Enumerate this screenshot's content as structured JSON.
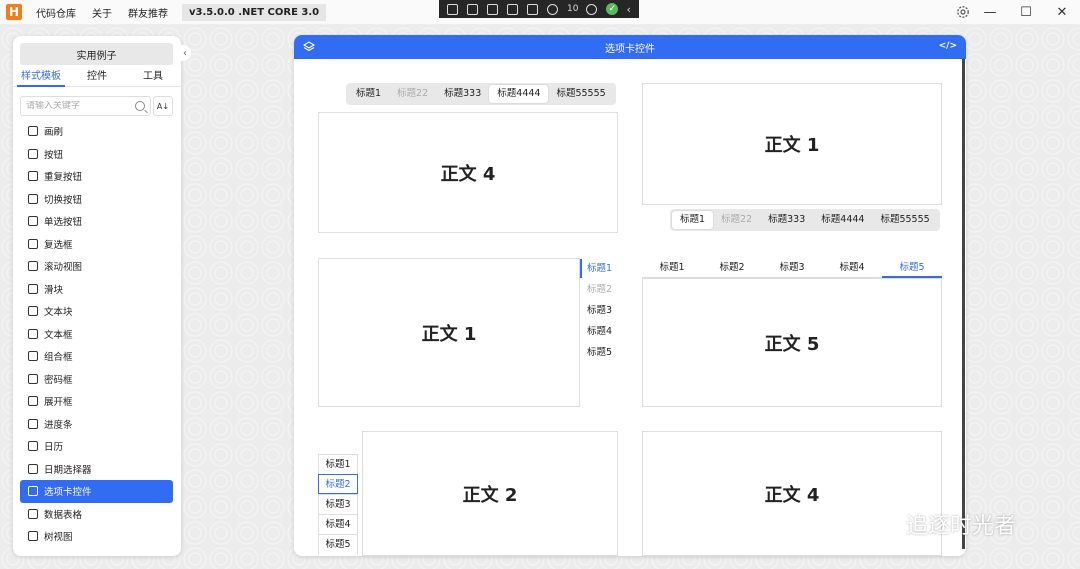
{
  "titlebar": {
    "logo": "H",
    "menu": [
      "代码仓库",
      "关于",
      "群友推荐"
    ],
    "version": "v3.5.0.0 .NET CORE 3.0",
    "debug_counter": "10",
    "controls": {
      "minimize": "—",
      "maximize": "☐",
      "close": "✕"
    }
  },
  "sidebar": {
    "examples_button": "实用例子",
    "tabs": [
      "样式模板",
      "控件",
      "工具"
    ],
    "active_tab": 0,
    "search_placeholder": "请输入关键字",
    "items": [
      {
        "label": "画刷",
        "icon": "brush-icon"
      },
      {
        "label": "按钮",
        "icon": "button-icon"
      },
      {
        "label": "重复按钮",
        "icon": "repeat-button-icon"
      },
      {
        "label": "切换按钮",
        "icon": "toggle-button-icon"
      },
      {
        "label": "单选按钮",
        "icon": "radio-icon"
      },
      {
        "label": "复选框",
        "icon": "checkbox-icon"
      },
      {
        "label": "滚动视图",
        "icon": "scrollview-icon"
      },
      {
        "label": "滑块",
        "icon": "slider-icon"
      },
      {
        "label": "文本块",
        "icon": "textblock-icon"
      },
      {
        "label": "文本框",
        "icon": "textbox-icon"
      },
      {
        "label": "组合框",
        "icon": "combobox-icon"
      },
      {
        "label": "密码框",
        "icon": "password-icon"
      },
      {
        "label": "展开框",
        "icon": "expander-icon"
      },
      {
        "label": "进度条",
        "icon": "progress-icon"
      },
      {
        "label": "日历",
        "icon": "calendar-icon"
      },
      {
        "label": "日期选择器",
        "icon": "datepicker-icon"
      },
      {
        "label": "选项卡控件",
        "icon": "tabcontrol-icon"
      },
      {
        "label": "数据表格",
        "icon": "datagrid-icon"
      },
      {
        "label": "树视图",
        "icon": "treeview-icon"
      }
    ],
    "active_item": 16
  },
  "main": {
    "title": "选项卡控件",
    "tabs_labels": [
      "标题1",
      "标题22",
      "标题333",
      "标题4444",
      "标题55555"
    ],
    "panel_top_left": {
      "active": 3,
      "disabled": [
        1
      ],
      "content": "正文 4"
    },
    "panel_top_right": {
      "active": 0,
      "disabled": [
        1
      ],
      "content": "正文 1"
    },
    "vertical_labels": [
      "标题1",
      "标题2",
      "标题3",
      "标题4",
      "标题5"
    ],
    "panel_mid_left": {
      "active": 0,
      "disabled": [
        1
      ],
      "content": "正文 1"
    },
    "panel_mid_right": {
      "active": 4,
      "content": "正文 5"
    },
    "panel_bottom_left": {
      "active": 1,
      "content": "正文 2"
    },
    "panel_bottom_right": {
      "content": "正文 4"
    },
    "accent_color": "#326cf3"
  },
  "watermark": {
    "text": "追逐时光者"
  }
}
